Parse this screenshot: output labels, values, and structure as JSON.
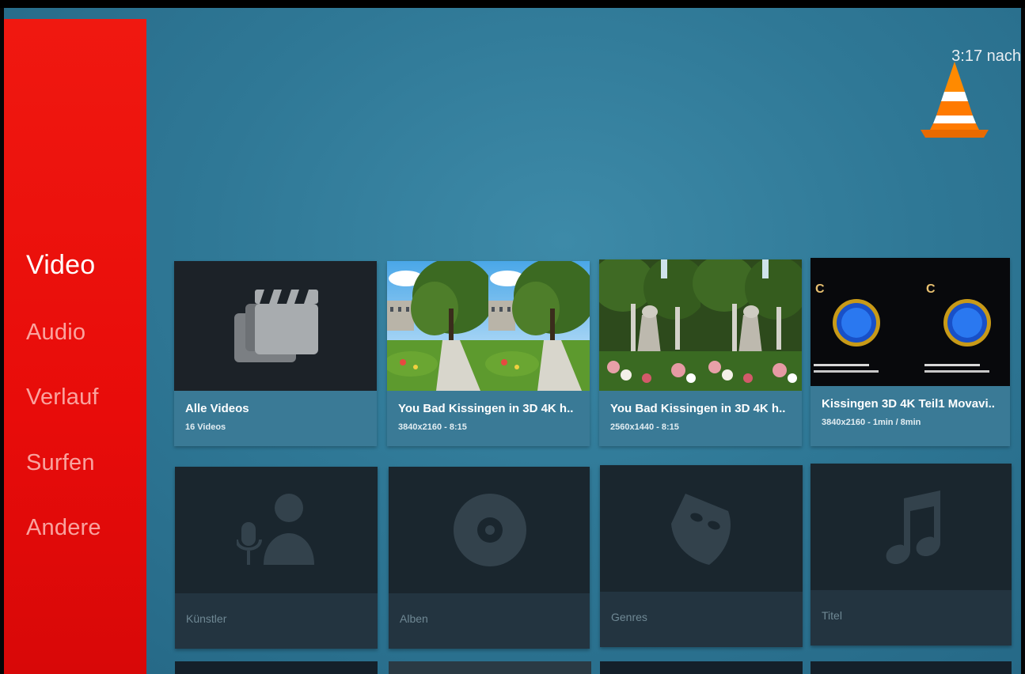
{
  "status": {
    "clock": "3:17 nach"
  },
  "logo": {
    "icon": "vlc-cone-icon"
  },
  "sidebar": {
    "items": [
      {
        "label": "Video",
        "active": true
      },
      {
        "label": "Audio",
        "active": false
      },
      {
        "label": "Verlauf",
        "active": false
      },
      {
        "label": "Surfen",
        "active": false
      },
      {
        "label": "Andere",
        "active": false
      }
    ]
  },
  "video_row": {
    "cards": [
      {
        "title": "Alle Videos",
        "subtitle": "16 Videos",
        "icon": "clapperboard-icon"
      },
      {
        "title": "You Bad Kissingen in 3D 4K h..",
        "subtitle": "3840x2160 - 8:15"
      },
      {
        "title": "You Bad Kissingen in 3D 4K h..",
        "subtitle": "2560x1440 - 8:15"
      },
      {
        "title": "Kissingen 3D 4K Teil1 Movavi..",
        "subtitle": "3840x2160 - 1min / 8min"
      }
    ]
  },
  "audio_row": {
    "cards": [
      {
        "label": "Künstler",
        "icon": "artist-microphone-icon"
      },
      {
        "label": "Alben",
        "icon": "disc-icon"
      },
      {
        "label": "Genres",
        "icon": "theater-mask-icon"
      },
      {
        "label": "Titel",
        "icon": "music-note-icon"
      }
    ]
  },
  "colors": {
    "sidebar": "#e80c0a",
    "background": "#2f7896",
    "accent": "#ff7a00"
  }
}
